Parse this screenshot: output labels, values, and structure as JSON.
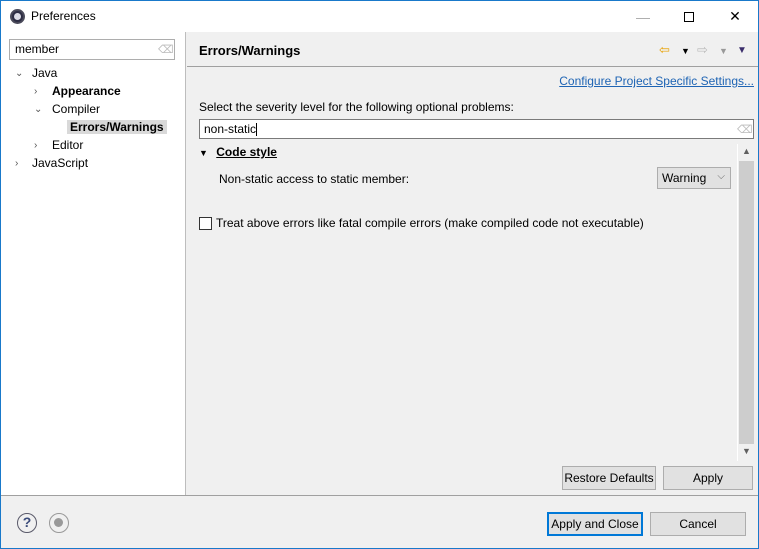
{
  "window": {
    "title": "Preferences"
  },
  "left": {
    "filter_value": "member",
    "tree": [
      {
        "label": "Java",
        "expanded": true
      },
      {
        "label": "Appearance",
        "expanded": false
      },
      {
        "label": "Compiler",
        "expanded": true
      },
      {
        "label": "Errors/Warnings",
        "selected": true
      },
      {
        "label": "Editor",
        "expanded": false
      },
      {
        "label": "JavaScript",
        "expanded": false
      }
    ]
  },
  "main": {
    "page_title": "Errors/Warnings",
    "configure_link": "Configure Project Specific Settings...",
    "severity_label": "Select the severity level for the following optional problems:",
    "filter_value": "non-static",
    "section_title": "Code style",
    "option_label": "Non-static access to static member:",
    "option_value": "Warning",
    "treat_label": "Treat above errors like fatal compile errors (make compiled code not executable)",
    "treat_checked": false,
    "restore_defaults": "Restore Defaults",
    "apply": "Apply"
  },
  "footer": {
    "apply_close": "Apply and Close",
    "cancel": "Cancel"
  },
  "colors": {
    "accent": "#0078d7",
    "link": "#1e64b4",
    "window_border": "#1979ca"
  }
}
